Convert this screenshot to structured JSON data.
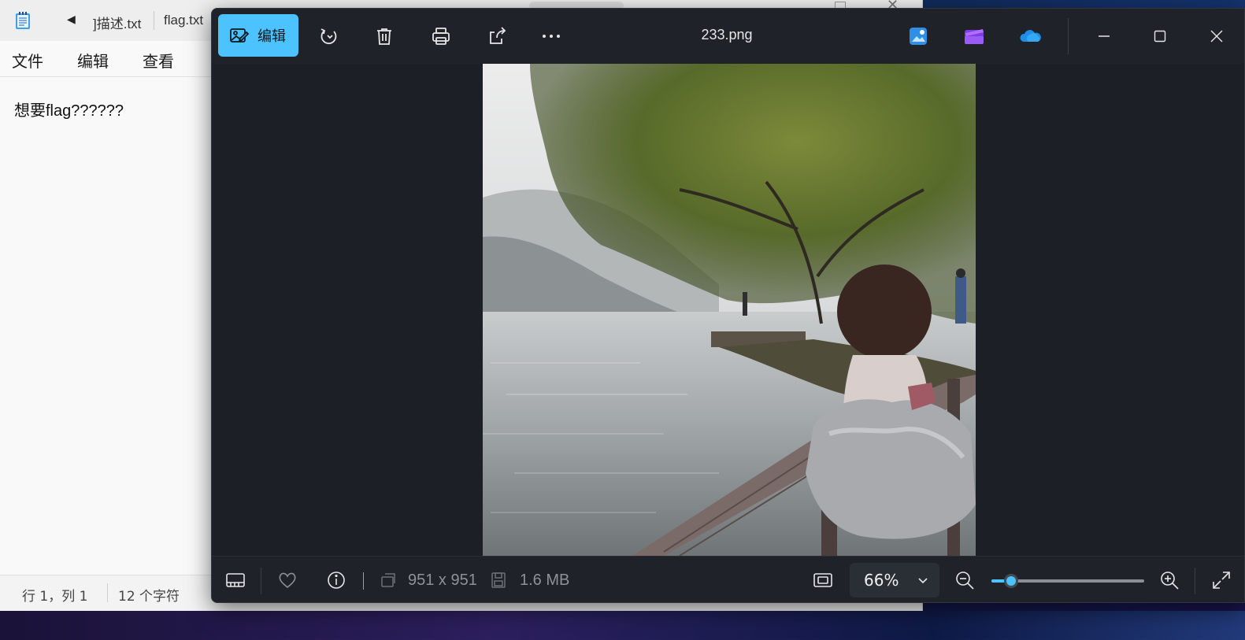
{
  "notepad": {
    "tabs": [
      "]描述.txt",
      "flag.txt"
    ],
    "menu": [
      "文件",
      "编辑",
      "查看"
    ],
    "content": "想要flag??????",
    "status": {
      "position": "行 1，列 1",
      "chars": "12 个字符"
    }
  },
  "viewer": {
    "edit_label": "编辑",
    "file_name": "233.png",
    "dimensions": "951 x 951",
    "file_size": "1.6 MB",
    "zoom_value": "66%",
    "zoom_fraction": 0.13,
    "icons": {
      "edit": "edit-icon",
      "rotate": "rotate-icon",
      "delete": "delete-icon",
      "print": "print-icon",
      "share": "share-icon",
      "more": "more-icon",
      "photos_app": "photos-app-icon",
      "clipchamp": "clipchamp-icon",
      "onedrive": "onedrive-icon",
      "minimize": "minimize-icon",
      "maximize": "maximize-icon",
      "close": "close-icon",
      "filmstrip": "filmstrip-icon",
      "favorite": "heart-icon",
      "info": "info-icon",
      "fit": "fit-to-window-icon",
      "zoom_out": "zoom-out-icon",
      "zoom_in": "zoom-in-icon",
      "fullscreen": "fullscreen-icon"
    },
    "accent": "#4cc2ff"
  }
}
